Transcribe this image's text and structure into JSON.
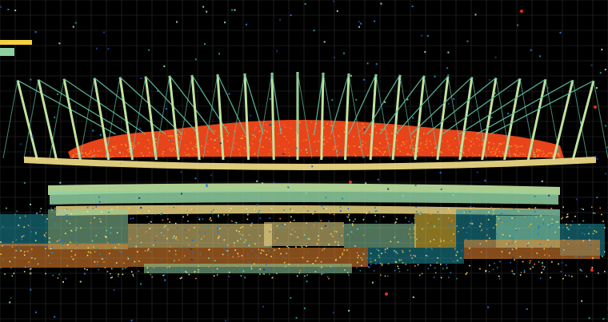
{
  "scene": {
    "description_free": true,
    "colors": {
      "background": "#000000",
      "grid": "#2e2e2e",
      "roof_fill": "#e8441a",
      "roof_edge": "#f0a030",
      "cable": "#5fbfa0",
      "mast": "#bfe3a0",
      "facade_light": "#f5e08a",
      "facade_mid": "#8fd0a0",
      "facade_dark": "#1f8fa0",
      "yellow": "#f5d040",
      "orange": "#f08a30",
      "blue": "#2a6fd0",
      "navy": "#1a3a8a",
      "red_dot": "#e03020"
    }
  }
}
